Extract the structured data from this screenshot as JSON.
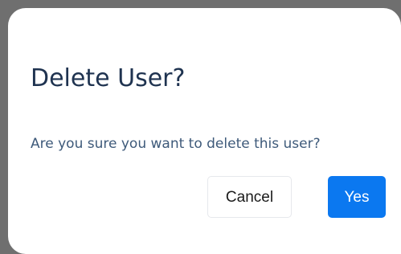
{
  "dialog": {
    "title": "Delete User?",
    "message": "Are you sure you want to delete this user?",
    "cancel_label": "Cancel",
    "confirm_label": "Yes"
  },
  "colors": {
    "title": "#1f3350",
    "message": "#3e5a7a",
    "primary_button": "#0b78f0",
    "backdrop": "#6f6f6f"
  }
}
